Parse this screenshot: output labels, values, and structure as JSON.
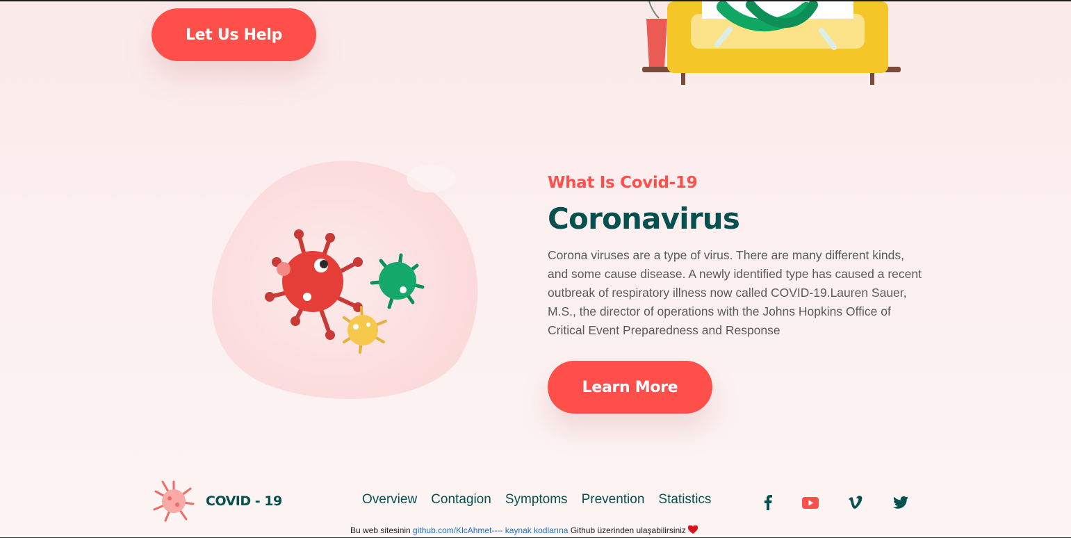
{
  "hero": {
    "help_button": "Let Us Help"
  },
  "about": {
    "eyebrow": "What Is Covid-19",
    "title": "Coronavirus",
    "description": "Corona viruses are a type of virus. There are many different kinds, and some cause disease. A newly identified type has caused a recent outbreak of respiratory illness now called COVID-19.Lauren Sauer, M.S., the director of operations with the Johns Hopkins Office of Critical Event Preparedness and Response",
    "learn_button": "Learn More"
  },
  "footer": {
    "logo_text": "COVID - 19",
    "nav": [
      "Overview",
      "Contagion",
      "Symptoms",
      "Prevention",
      "Statistics"
    ],
    "social_icons": [
      "facebook-icon",
      "youtube-icon",
      "vimeo-icon",
      "twitter-icon"
    ],
    "credit_prefix": "Bu web sitesinin ",
    "credit_link": "github.com/KlcAhmet---- kaynak kodlarına",
    "credit_suffix": " Github üzerinden ulaşabilirsiniz "
  },
  "colors": {
    "accent": "#ff4f4a",
    "brand_dark": "#06514f",
    "background": "#fcefef"
  }
}
